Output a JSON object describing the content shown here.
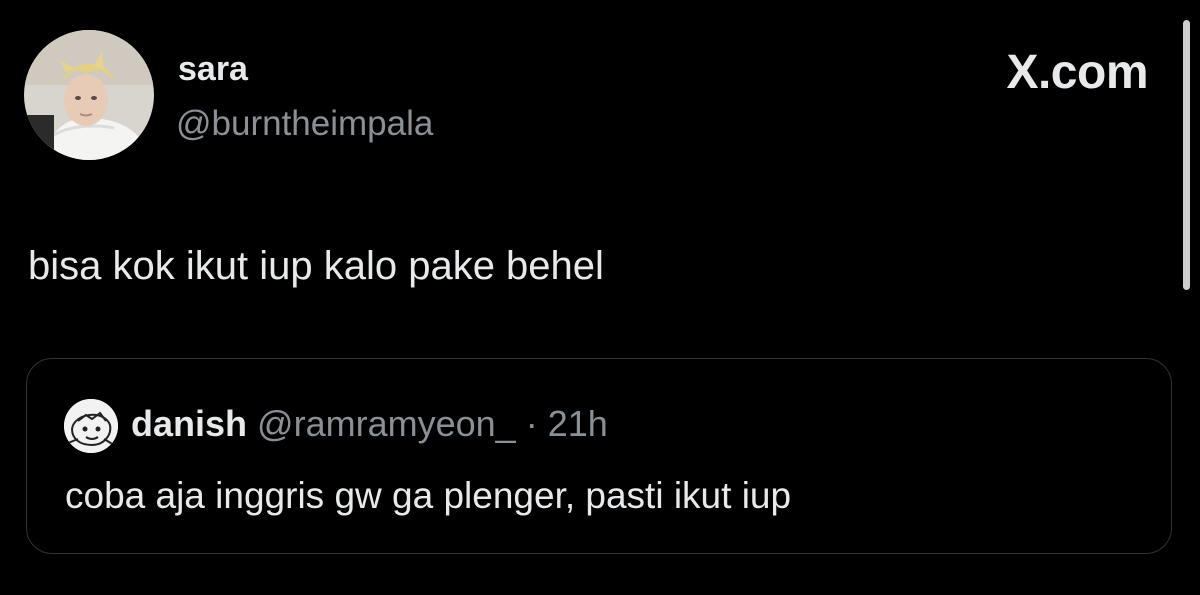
{
  "tweet": {
    "author": {
      "name": "sara",
      "handle": "@burntheimpala"
    },
    "brand": "X.com",
    "text": "bisa kok ikut iup kalo pake behel",
    "quoted": {
      "name": "danish",
      "handle": "@ramramyeon_",
      "separator": "·",
      "time": "21h",
      "text": "coba aja inggris gw ga plenger, pasti ikut iup"
    }
  },
  "colors": {
    "background": "#000000",
    "primary_text": "#e7e9ea",
    "secondary_text": "#8b9096",
    "border": "#2f3336"
  }
}
